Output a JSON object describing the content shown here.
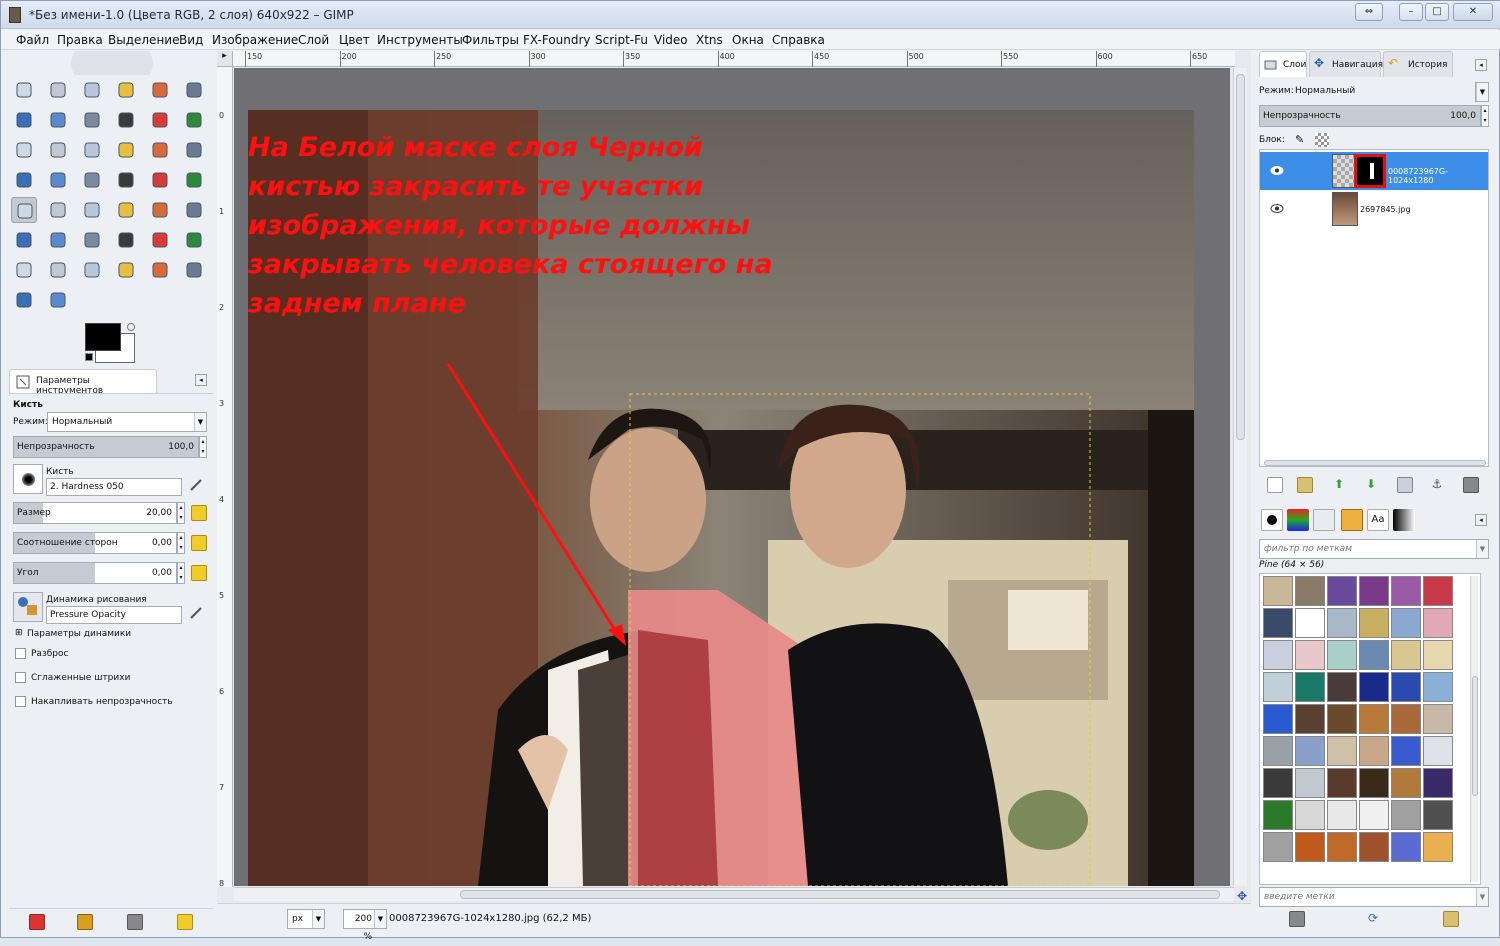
{
  "window": {
    "title": "*Без имени-1.0 (Цвета RGB, 2 слоя) 640x922 – GIMP",
    "minimize": "–",
    "maximize": "□",
    "close": "✕",
    "restore": "⇔"
  },
  "menu": [
    "Файл",
    "Правка",
    "Выделение",
    "Вид",
    "Изображение",
    "Слой",
    "Цвет",
    "Инструменты",
    "Фильтры",
    "FX-Foundry",
    "Script-Fu",
    "Video",
    "Xtns",
    "Окна",
    "Справка"
  ],
  "tool_options": {
    "tab_label": "Параметры инструментов",
    "tool_name": "Кисть",
    "mode_label": "Режим:",
    "mode_value": "Нормальный",
    "opacity_label": "Непрозрачность",
    "opacity_value": "100,0",
    "brush_label": "Кисть",
    "brush_value": "2. Hardness 050",
    "size_label": "Размер",
    "size_value": "20,00",
    "aspect_label": "Соотношение сторон",
    "aspect_value": "0,00",
    "angle_label": "Угол",
    "angle_value": "0,00",
    "dynamics_label": "Динамика рисования",
    "dynamics_value": "Pressure Opacity",
    "dynamics_options": "Параметры динамики",
    "scatter": "Разброс",
    "smooth": "Сглаженные штрихи",
    "incremental": "Накапливать непрозрачность"
  },
  "ruler": {
    "h_ticks": [
      "150",
      "200",
      "250",
      "300",
      "350",
      "400",
      "450",
      "500",
      "550",
      "600",
      "650"
    ],
    "v_ticks": [
      "0",
      "1",
      "2",
      "3",
      "4",
      "5",
      "6",
      "7",
      "8"
    ]
  },
  "canvas": {
    "annotation": "На Белой маске слоя Черной кистью закрасить те участки изображения, которые должны закрывать человека стоящего на заднем плане"
  },
  "status": {
    "unit": "px",
    "zoom": "200 %",
    "info": "0008723967G-1024x1280.jpg (62,2 МБ)"
  },
  "layers_panel": {
    "tabs": [
      "Слои",
      "Навигация",
      "История"
    ],
    "mode_label": "Режим:",
    "mode_value": "Нормальный",
    "opacity_label": "Непрозрачность",
    "opacity_value": "100,0",
    "lock_label": "Блок:",
    "layers": [
      {
        "name": "0008723967G-1024x1280"
      },
      {
        "name": "2697845.jpg"
      }
    ]
  },
  "patterns_panel": {
    "filter_placeholder": "фильтр по меткам",
    "current": "Pine (64 × 56)",
    "tags_placeholder": "введите метки"
  },
  "colors": {
    "accent": "#3d8ee6",
    "annotation_red": "#ff1010"
  }
}
